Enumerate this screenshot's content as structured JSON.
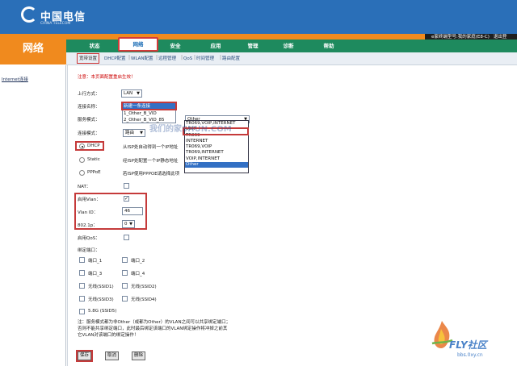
{
  "header": {
    "logo_text": "中国电信",
    "logo_sub": "CHINA TELECOM",
    "model_label": "e家终端型号:",
    "model_value": "我的家庭(E8-C)",
    "logout": "退出登"
  },
  "section_title": "网络",
  "tabs": [
    {
      "label": "状态"
    },
    {
      "label": "网络"
    },
    {
      "label": "安全"
    },
    {
      "label": "应用"
    },
    {
      "label": "管理"
    },
    {
      "label": "诊断"
    },
    {
      "label": "帮助"
    }
  ],
  "subnav": [
    "宽带设置",
    "DHCP配置",
    "WLAN配置",
    "远程管理",
    "QoS",
    "时间管理",
    "路由配置"
  ],
  "sidebar": {
    "link": "Internet连接"
  },
  "note": "注意：本页面配置重启生效！",
  "form": {
    "uplink_label": "上行方式：",
    "uplink_value": "LAN",
    "conn_name_label": "连接名称：",
    "conn_name_options": [
      "新建一条连接",
      "1_Other_B_VID",
      "2_Other_B_VID_85"
    ],
    "service_label": "服务模式：",
    "service_value": "Other",
    "service_options": [
      "TR069,VOIP,INTERNET",
      "VOIP",
      "TR069",
      "INTERNET",
      "TR069,VOIP",
      "TR069,INTERNET",
      "VOIP,INTERNET",
      "Other"
    ],
    "conn_mode_label": "连接模式：",
    "conn_mode_value": "路由",
    "dhcp_label": "DHCP",
    "dhcp_desc": "从ISP处自动得到一个IP地址",
    "static_label": "Static",
    "static_desc": "经ISP处配置一个IP静态地址",
    "pppoe_label": "PPPoE",
    "pppoe_desc": "若ISP使用PPPOE请选择此项",
    "nat_label": "NAT：",
    "vlan_enable_label": "启用Vlan：",
    "vlan_id_label": "Vlan ID：",
    "vlan_id_value": "46",
    "dot1p_label": "802.1p：",
    "dot1p_value": "0",
    "qos_label": "启用QoS：",
    "bind_label": "绑定端口：",
    "ports": [
      "端口_1",
      "端口_2",
      "端口_3",
      "端口_4",
      "无线(SSID1)",
      "无线(SSID2)",
      "无线(SSID3)",
      "无线(SSID4)",
      "5.8G (SSID5)"
    ],
    "footnote_1": "注：服务模式都为非Other（或都为Other）的VLAN之间可以共享绑定端口；",
    "footnote_2": "否则不能共享绑定端口，此时最后绑定该端口的VLAN绑定操作将冲掉之前其",
    "footnote_3": "它VLAN对该端口的绑定操作！"
  },
  "buttons": {
    "save": "保存",
    "cancel": "取消",
    "delete": "删除"
  },
  "watermark": "我们的家SHUN.COM",
  "fly": {
    "title": "FLY社区",
    "url": "bbs.0xy.cn"
  }
}
